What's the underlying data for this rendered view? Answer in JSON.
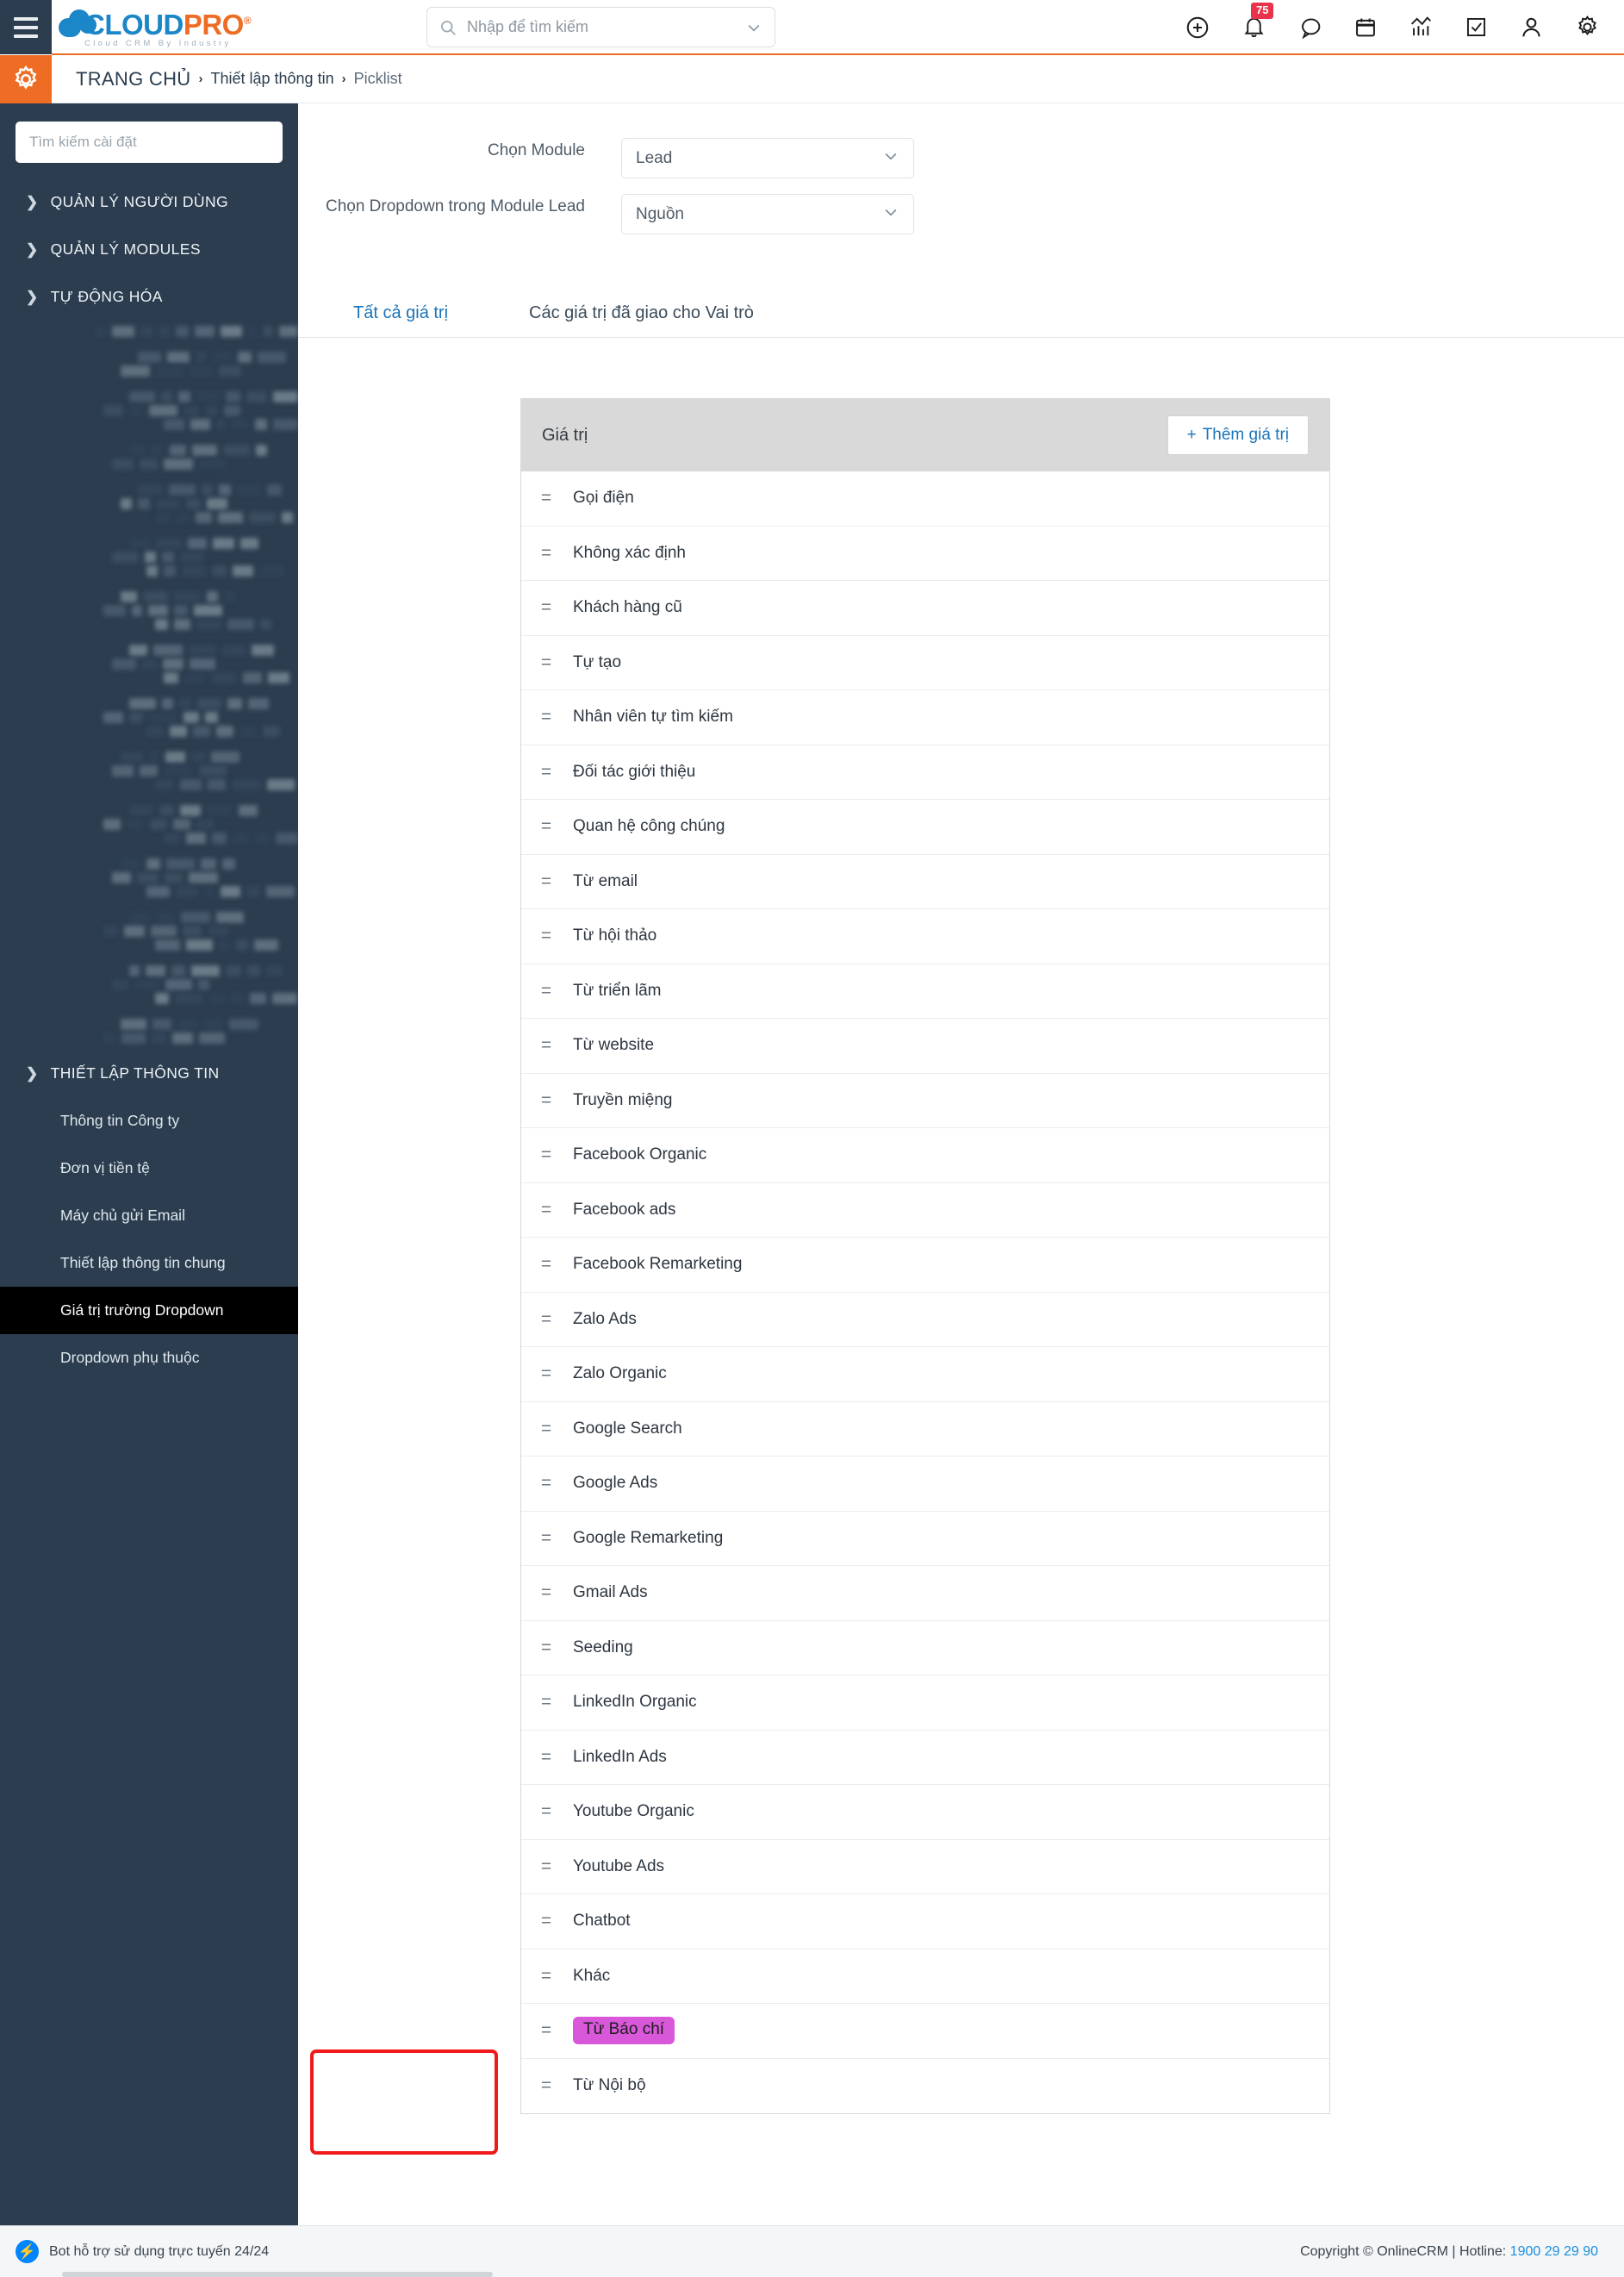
{
  "header": {
    "brand_main_cloud": "CLOUD",
    "brand_main_pro": "PRO",
    "brand_reg": "®",
    "brand_sub": "Cloud  CRM  By  Industry",
    "search_placeholder": "Nhập để tìm kiếm",
    "notification_count": "75",
    "icons": [
      "add-icon",
      "bell-icon",
      "chat-icon",
      "calendar-icon",
      "analytics-icon",
      "task-icon",
      "user-icon",
      "settings-icon"
    ]
  },
  "breadcrumb": {
    "home": "TRANG CHỦ",
    "sep": "›",
    "middle": "Thiết lập thông tin",
    "current": "Picklist"
  },
  "sidebar": {
    "search_placeholder": "Tìm kiếm cài đặt",
    "groups": [
      {
        "label": "QUẢN LÝ NGƯỜI DÙNG",
        "expanded": false
      },
      {
        "label": "QUẢN LÝ MODULES",
        "expanded": false
      },
      {
        "label": "TỰ ĐỘNG HÓA",
        "expanded": false
      }
    ],
    "settings_group": {
      "label": "THIẾT LẬP THÔNG TIN",
      "expanded": true
    },
    "settings_items": [
      {
        "label": "Thông tin Công ty",
        "active": false
      },
      {
        "label": "Đơn vị tiền tệ",
        "active": false
      },
      {
        "label": "Máy chủ gửi Email",
        "active": false
      },
      {
        "label": "Thiết lập thông tin chung",
        "active": false
      },
      {
        "label": "Giá trị trường Dropdown",
        "active": true
      },
      {
        "label": "Dropdown phụ thuộc",
        "active": false
      }
    ]
  },
  "form": {
    "module_label": "Chọn Module",
    "module_value": "Lead",
    "dropdown_label": "Chọn Dropdown trong Module Lead",
    "dropdown_value": "Nguồn"
  },
  "tabs": [
    {
      "label": "Tất cả giá trị",
      "active": true
    },
    {
      "label": "Các giá trị đã giao cho Vai trò",
      "active": false
    }
  ],
  "panel": {
    "title": "Giá trị",
    "add_button": "Thêm giá trị",
    "add_icon": "+"
  },
  "values": [
    {
      "label": "Gọi điện",
      "highlighted": false
    },
    {
      "label": "Không xác định",
      "highlighted": false
    },
    {
      "label": "Khách hàng cũ",
      "highlighted": false
    },
    {
      "label": "Tự tạo",
      "highlighted": false
    },
    {
      "label": "Nhân viên tự tìm kiếm",
      "highlighted": false
    },
    {
      "label": "Đối tác giới thiệu",
      "highlighted": false
    },
    {
      "label": "Quan hệ công chúng",
      "highlighted": false
    },
    {
      "label": "Từ email",
      "highlighted": false
    },
    {
      "label": "Từ hội thảo",
      "highlighted": false
    },
    {
      "label": "Từ triển lãm",
      "highlighted": false
    },
    {
      "label": "Từ website",
      "highlighted": false
    },
    {
      "label": "Truyền miệng",
      "highlighted": false
    },
    {
      "label": "Facebook Organic",
      "highlighted": false
    },
    {
      "label": "Facebook ads",
      "highlighted": false
    },
    {
      "label": "Facebook Remarketing",
      "highlighted": false
    },
    {
      "label": "Zalo Ads",
      "highlighted": false
    },
    {
      "label": "Zalo Organic",
      "highlighted": false
    },
    {
      "label": "Google Search",
      "highlighted": false
    },
    {
      "label": "Google Ads",
      "highlighted": false
    },
    {
      "label": "Google Remarketing",
      "highlighted": false
    },
    {
      "label": "Gmail Ads",
      "highlighted": false
    },
    {
      "label": "Seeding",
      "highlighted": false
    },
    {
      "label": "LinkedIn Organic",
      "highlighted": false
    },
    {
      "label": "LinkedIn Ads",
      "highlighted": false
    },
    {
      "label": "Youtube Organic",
      "highlighted": false
    },
    {
      "label": "Youtube Ads",
      "highlighted": false
    },
    {
      "label": "Chatbot",
      "highlighted": false
    },
    {
      "label": "Khác",
      "highlighted": false
    },
    {
      "label": "Từ Báo chí",
      "highlighted": true
    },
    {
      "label": "Từ Nội bộ",
      "highlighted": false
    }
  ],
  "footer": {
    "bot_text": "Bot hỗ trợ sử dụng trực tuyến 24/24",
    "copyright": "Copyright © OnlineCRM | Hotline: ",
    "hotline": "1900 29 29 90"
  },
  "colors": {
    "brand_blue": "#1b86c8",
    "brand_orange": "#ef6c24",
    "sidebar_bg": "#2b3d4f",
    "accent_link": "#1c74b8",
    "highlight_chip": "#d957d9",
    "redbox": "#f11a1a",
    "badge": "#e8334a"
  }
}
